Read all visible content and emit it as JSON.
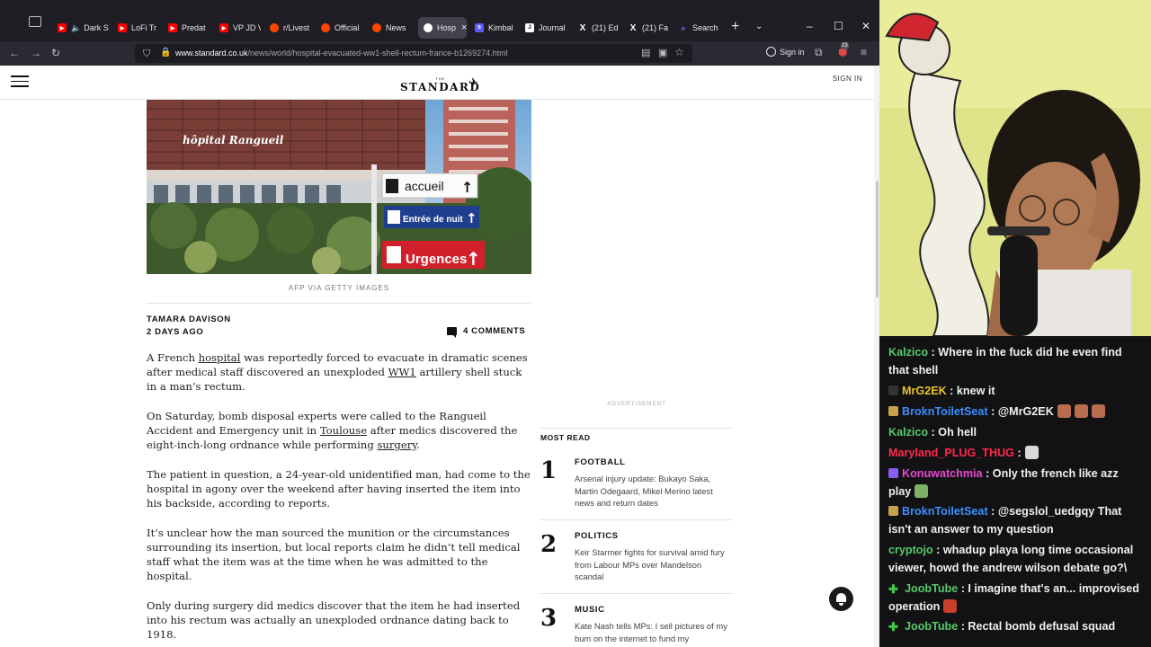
{
  "browser": {
    "tabs": [
      {
        "label": "Dark S",
        "favicon_color": "#ff0000"
      },
      {
        "label": "LoFi Tr",
        "favicon_color": "#ff0000"
      },
      {
        "label": "Predat",
        "favicon_color": "#ff0000"
      },
      {
        "label": "VP JD V",
        "favicon_color": "#ff0000"
      },
      {
        "label": "r/Livest",
        "favicon_color": "#ff4500"
      },
      {
        "label": "Official",
        "favicon_color": "#ff4500"
      },
      {
        "label": "News",
        "favicon_color": "#ff4500"
      },
      {
        "label": "Hosp",
        "favicon_color": "#ffffff",
        "active": true
      },
      {
        "label": "Kimbal",
        "favicon_color": "#5a5aff"
      },
      {
        "label": "Journal",
        "favicon_color": "#ffffff"
      },
      {
        "label": "(21) Ed",
        "favicon_color": "#ffffff"
      },
      {
        "label": "(21) Fa",
        "favicon_color": "#ffffff"
      },
      {
        "label": "Search",
        "favicon_color": "#7b6cf0"
      }
    ],
    "url_host": "www.standard.co.uk",
    "url_path": "/news/world/hospital-evacuated-ww1-shell-rectum-france-b1269274.html",
    "signin_label": "Sign in",
    "extension_badge": "23"
  },
  "site": {
    "logo_the": "THE",
    "logo_name": "STANDARD",
    "signin_label": "SIGN IN"
  },
  "article": {
    "hero_sign_hospital": "hôpital Rangueil",
    "hero_sign_1": "accueil",
    "hero_sign_2": "Entrée de nuit",
    "hero_sign_3": "Urgences",
    "caption": "AFP VIA GETTY IMAGES",
    "author": "TAMARA DAVISON",
    "date": "2 DAYS AGO",
    "comments": "4 COMMENTS",
    "p1_a": "A French ",
    "p1_link1": "hospital",
    "p1_b": " was reportedly forced to evacuate in dramatic scenes after medical staff discovered an unexploded ",
    "p1_link2": "WW1",
    "p1_c": " artillery shell stuck in a man’s rectum.",
    "p2_a": "On Saturday, bomb disposal experts were called to the Rangueil Accident and Emergency unit in ",
    "p2_link1": "Toulouse",
    "p2_b": " after medics discovered the eight-inch-long ordnance while performing ",
    "p2_link2": "surgery",
    "p2_c": ".",
    "p3": "The patient in question, a 24-year-old unidentified man, had come to the hospital in agony over the weekend after having inserted the item into his backside, according to reports.",
    "p4": "It’s unclear how the man sourced the munition or the circumstances surrounding its insertion, but local reports claim he didn’t tell medical staff what the item was at the time when he was admitted to the hospital.",
    "p5": "Only during surgery did medics discover that the item he had inserted into his rectum was actually an unexploded ordnance dating back to 1918."
  },
  "sidebar": {
    "ad_label": "ADVERTISEMENT",
    "most_read_title": "MOST READ",
    "items": [
      {
        "num": "1",
        "category": "FOOTBALL",
        "headline": "Arsenal injury update: Bukayo Saka, Martin Odegaard, Mikel Merino latest news and return dates"
      },
      {
        "num": "2",
        "category": "POLITICS",
        "headline": "Keir Starmer fights for survival amid fury from Labour MPs over Mandelson scandal"
      },
      {
        "num": "3",
        "category": "MUSIC",
        "headline": "Kate Nash tells MPs: I sell pictures of my bum on the internet to fund my"
      }
    ]
  },
  "chat": {
    "messages": [
      {
        "user": "Kalzico",
        "color": "#58c86a",
        "text": " : Where in the fuck did he even find that shell"
      },
      {
        "user": "MrG2EK",
        "color": "#e8c32a",
        "text": " : knew it"
      },
      {
        "user": "BroknToiletSeat",
        "color": "#3a8fff",
        "text": " : @MrG2EK"
      },
      {
        "user": "Kalzico",
        "color": "#58c86a",
        "text": " : Oh hell"
      },
      {
        "user": "Maryland_PLUG_THUG",
        "color": "#ff2b4a",
        "text": " :"
      },
      {
        "user": "Konuwatchmia",
        "color": "#e64bd2",
        "text": " : Only the french like azz play"
      },
      {
        "user": "BroknToiletSeat",
        "color": "#3a8fff",
        "text": " : @segslol_uedgqy That isn't an answer to my question"
      },
      {
        "user": "cryptojo",
        "color": "#58c86a",
        "text": " : whadup playa long time occasional viewer, howd the andrew wilson debate go?\\"
      },
      {
        "user": "JoobTube",
        "color": "#58c86a",
        "text": " : I imagine that's an... improvised operation"
      },
      {
        "user": "JoobTube",
        "color": "#58c86a",
        "text": " : Rectal bomb defusal squad"
      }
    ]
  }
}
